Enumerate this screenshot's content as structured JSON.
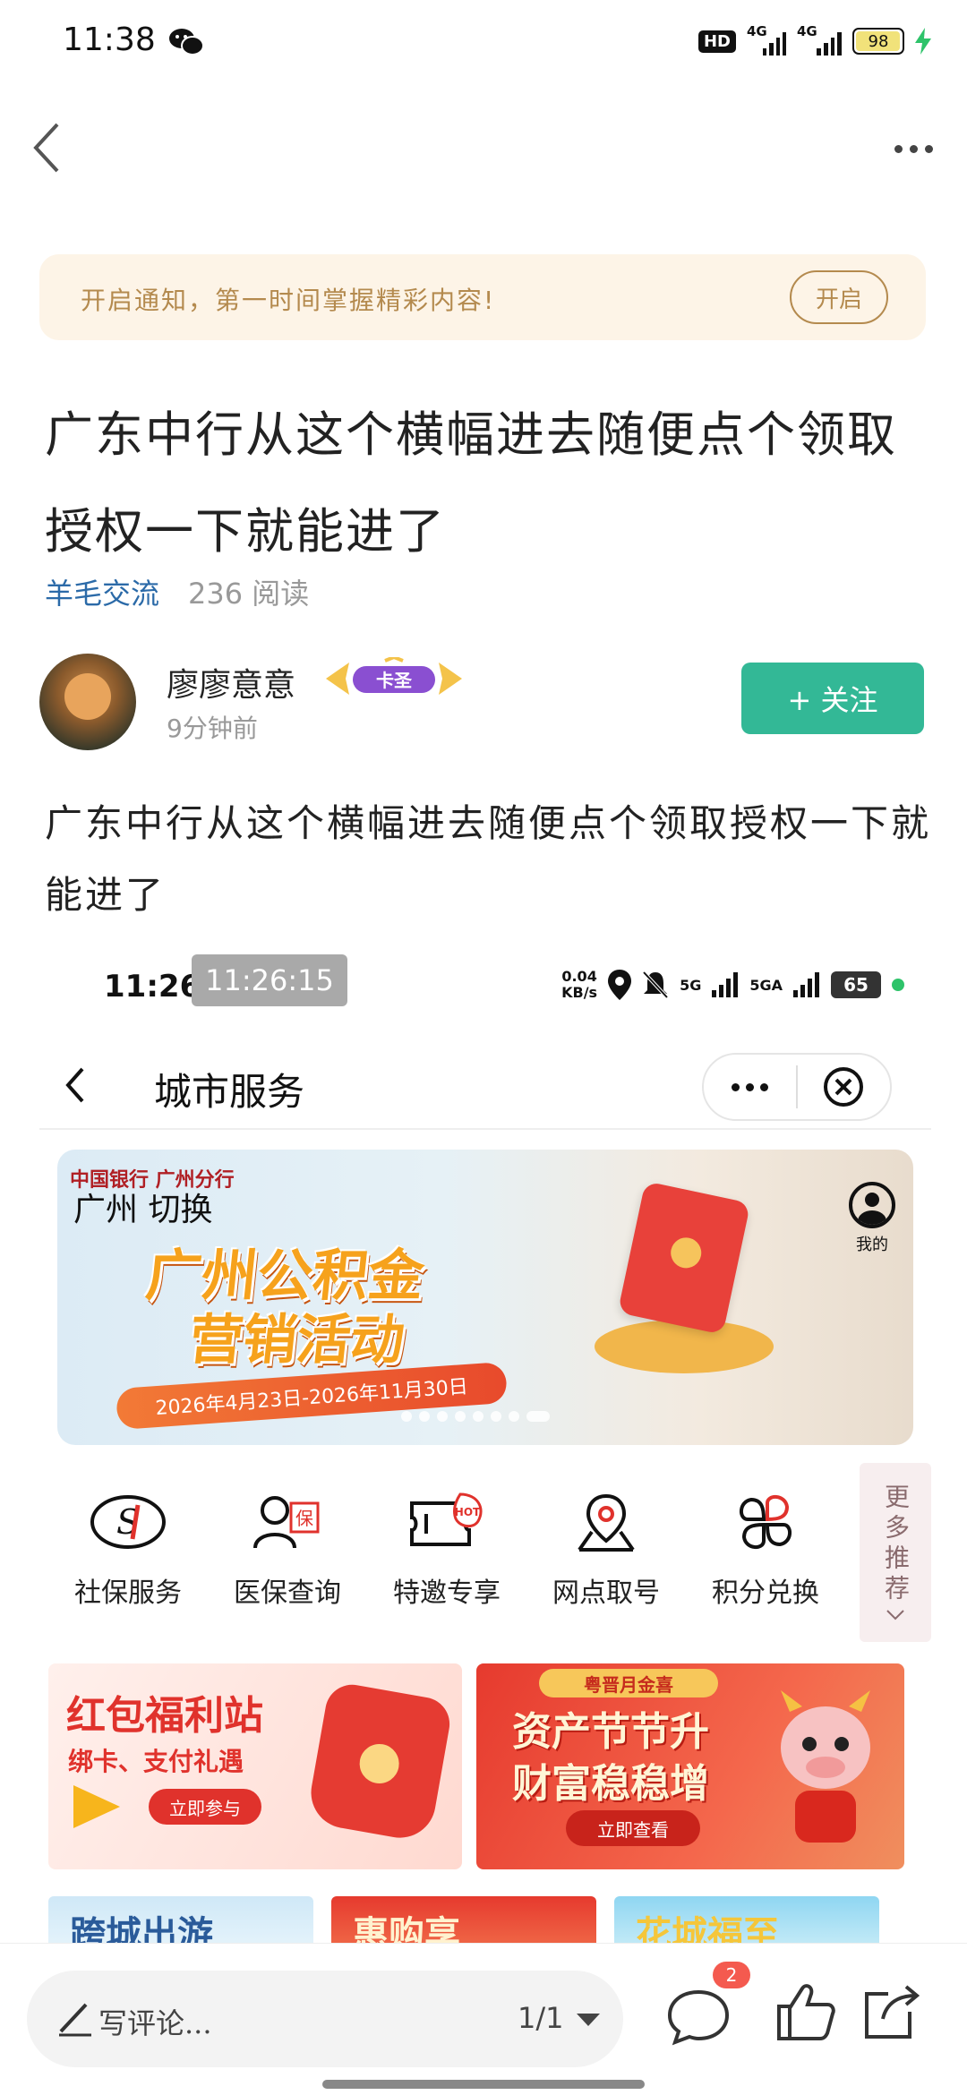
{
  "status_bar": {
    "time": "11:38",
    "hd_label": "HD",
    "sim1_label": "4G",
    "sim2_label": "4G",
    "battery": "98",
    "battery_level_percent": 98
  },
  "nav": {
    "back_icon": "chevron-left-icon",
    "more_icon": "more-dots-icon"
  },
  "notify_bar": {
    "text": "开启通知，第一时间掌握精彩内容!",
    "button": "开启"
  },
  "post": {
    "title": "广东中行从这个横幅进去随便点个领取授权一下就能进了",
    "tag": "羊毛交流",
    "reads": "236 阅读",
    "author": {
      "name": "廖廖意意",
      "badge": "卡圣",
      "time": "9分钟前"
    },
    "follow_label": "+ 关注",
    "body": "广东中行从这个横幅进去随便点个领取授权一下就能进了"
  },
  "screenshot": {
    "status": {
      "time": "11:26",
      "time_overlay": "11:26:15",
      "net_speed_value": "0.04",
      "net_speed_unit": "KB/s",
      "sim1": "5G",
      "sim2": "5GA",
      "battery": "65"
    },
    "page_title": "城市服务",
    "banner": {
      "bank": "中国银行 广州分行",
      "city_switch": "广州 切换",
      "title_line1": "广州公积金",
      "title_line2": "营销活动",
      "date_range": "2026年4月23日-2026年11月30日",
      "mine_label": "我的"
    },
    "services": [
      {
        "label": "社保服务",
        "icon": "social-security-icon"
      },
      {
        "label": "医保查询",
        "icon": "medical-insurance-icon"
      },
      {
        "label": "特邀专享",
        "icon": "hot-ticket-icon"
      },
      {
        "label": "网点取号",
        "icon": "location-pin-icon"
      },
      {
        "label": "积分兑换",
        "icon": "points-clover-icon"
      }
    ],
    "more_services": "更多推荐",
    "promo1": {
      "title": "红包福利站",
      "subtitle": "绑卡、支付礼遇",
      "button": "立即参与"
    },
    "promo2": {
      "top_tag": "粤晋月金喜",
      "title_line1": "资产节节升",
      "title_line2": "财富稳稳增",
      "button": "立即查看"
    },
    "row3": [
      "跨城出游",
      "惠购享",
      "花城福至"
    ]
  },
  "bottom_bar": {
    "comment_placeholder": "写评论...",
    "page_indicator": "1/1",
    "comment_count": "2"
  }
}
